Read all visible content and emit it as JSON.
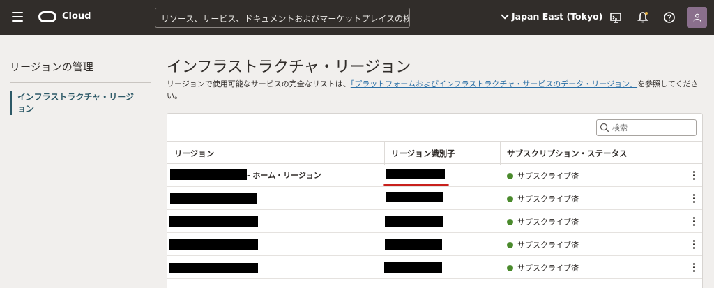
{
  "topbar": {
    "logo_text": "Cloud",
    "search_placeholder": "リソース、サービス、ドキュメントおよびマーケットプレイスの検索",
    "region": "Japan East (Tokyo)"
  },
  "sidebar": {
    "title": "リージョンの管理",
    "items": [
      {
        "label": "インフラストラクチャ・リージョン"
      }
    ]
  },
  "main": {
    "title": "インフラストラクチャ・リージョン",
    "desc_prefix": "リージョンで使用可能なサービスの完全なリストは、",
    "desc_link": "「プラットフォームおよびインフラストラクチャ・サービスのデータ・リージョン」",
    "desc_suffix": "を参照してください。"
  },
  "table": {
    "search_placeholder": "検索",
    "columns": [
      "リージョン",
      "リージョン識別子",
      "サブスクリプション・ステータス"
    ],
    "home_suffix": "- ホーム・リージョン",
    "rows": [
      {
        "status": "サブスクライブ済"
      },
      {
        "status": "サブスクライブ済"
      },
      {
        "status": "サブスクライブ済"
      },
      {
        "status": "サブスクライブ済"
      },
      {
        "status": "サブスクライブ済"
      }
    ]
  },
  "colors": {
    "topbar": "#312d2a",
    "accent": "#2d5967",
    "status_ok": "#4a8a2c",
    "highlight": "#c8201c"
  }
}
